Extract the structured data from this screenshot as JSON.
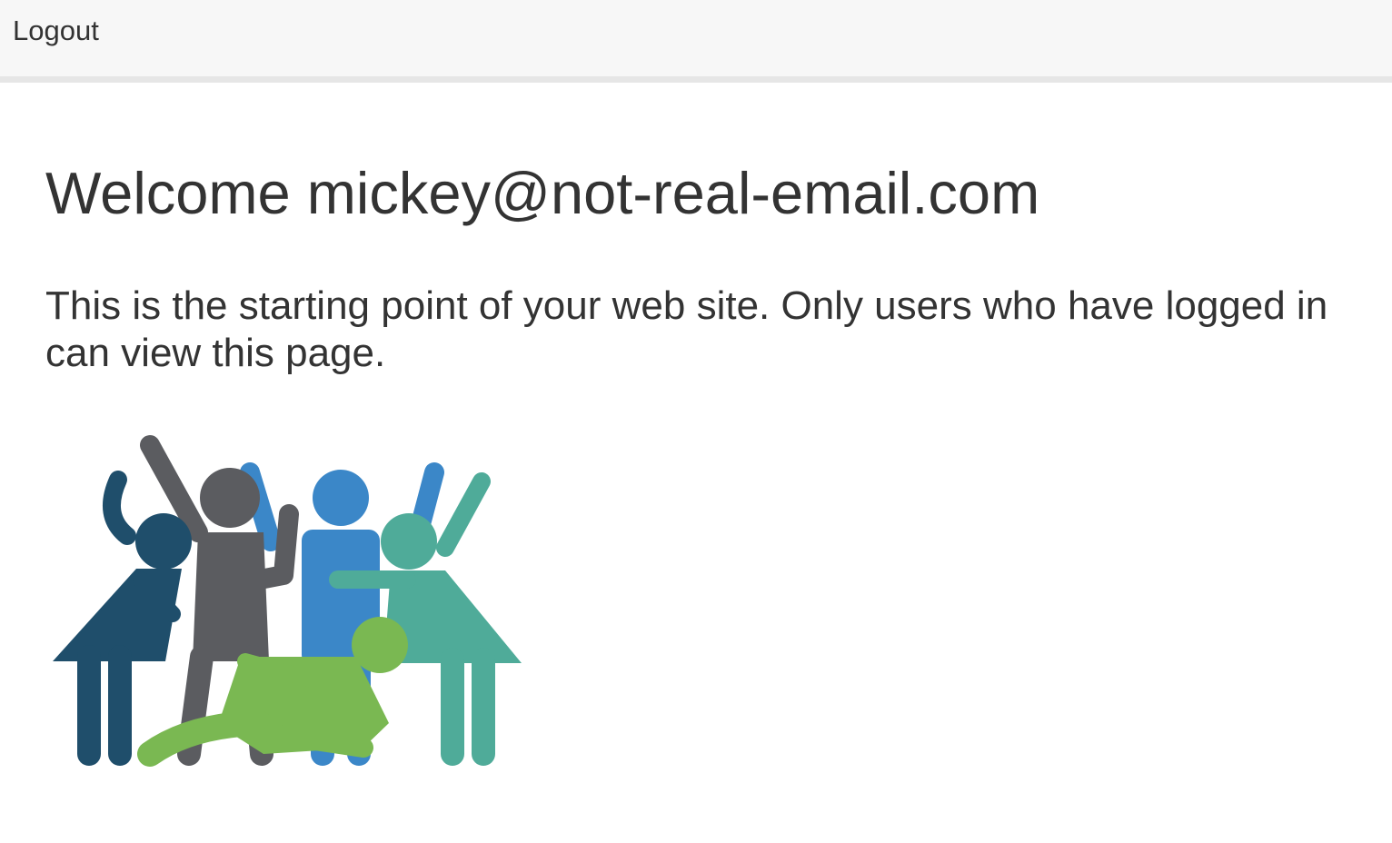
{
  "navbar": {
    "logout_label": "Logout"
  },
  "main": {
    "title": "Welcome mickey@not-real-email.com",
    "intro": "This is the starting point of your web site. Only users who have logged in can view this page."
  },
  "illustration": {
    "icon": "celebrating-people-icon",
    "colors": {
      "navy": "#1f4e6b",
      "gray": "#5b5c60",
      "blue": "#3b87c8",
      "teal": "#4fab99",
      "green": "#7ab852"
    }
  }
}
